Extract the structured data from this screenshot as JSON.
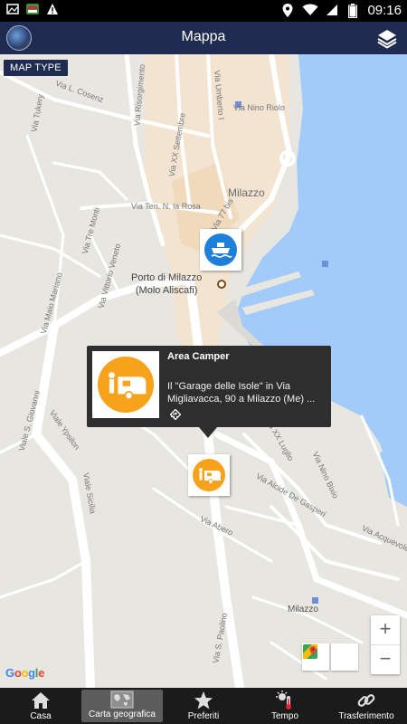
{
  "status_bar": {
    "time": "09:16"
  },
  "app_bar": {
    "title": "Mappa"
  },
  "map": {
    "map_type_label": "MAP TYPE",
    "streets": [
      "Via Tukery",
      "Via L. Cosenz",
      "Via Risorgimento",
      "Via Umberto I",
      "Via Nino Riolo",
      "Via XX Settembre",
      "Via Ten. N. la Rosa",
      "Via Tre Monti",
      "Via Vittorio Veneto",
      "Via Maio Mariano",
      "Via Mangiavacca",
      "Viale S. Giovanni",
      "Viale Ypsilon",
      "Viale Sicilia",
      "Via G. Garibaldi",
      "Via XX Luglio",
      "Via Nino Bixio",
      "Via Alcide De Gasperi",
      "Via Abero",
      "Via S. Paolino",
      "Via Acquevole",
      "Via Cristoforo Colombo",
      "Via 77 bis"
    ],
    "town_label": "Milazzo",
    "town_label_small": "Milazzo",
    "port_label_line1": "Porto di Milazzo",
    "port_label_line2": "(Molo Aliscafi)",
    "google_logo": "Google",
    "zoom_in": "+",
    "zoom_out": "−"
  },
  "info_window": {
    "title": "Area Camper",
    "description": "Il \"Garage delle Isole\" in Via Migliavacca, 90 a Milazzo (Me) ...",
    "nav_text": "..."
  },
  "colors": {
    "app_bar": "#1f2b50",
    "camper_marker": "#f7a21b",
    "ferry_marker": "#1e7fd8",
    "sea": "#a3cbfa",
    "land": "#e8e6e1"
  },
  "bottom_nav": {
    "items": [
      {
        "label": "Casa",
        "icon": "home-icon"
      },
      {
        "label": "Carta geografica",
        "icon": "world-map-icon"
      },
      {
        "label": "Preferiti",
        "icon": "star-icon"
      },
      {
        "label": "Tempo",
        "icon": "weather-icon"
      },
      {
        "label": "Trasferimento",
        "icon": "link-icon"
      }
    ]
  }
}
